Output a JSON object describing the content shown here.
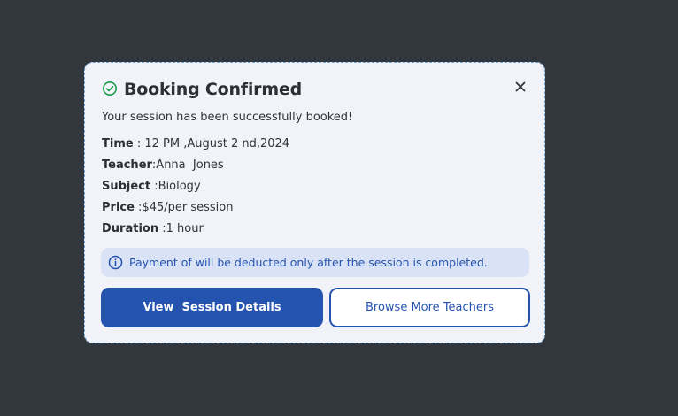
{
  "modal": {
    "title": "Booking Confirmed",
    "subtitle": "Your session has been successfully booked!",
    "close_icon": "close-icon",
    "status_icon": "check-circle-icon",
    "details": [
      {
        "key": "Time",
        "value": " : 12 PM ,August 2 nd,2024"
      },
      {
        "key": "Teacher",
        "value": ":Anna  Jones"
      },
      {
        "key": "Subject",
        "value": " :Biology"
      },
      {
        "key": "Price",
        "value": " :$45/per session"
      },
      {
        "key": "Duration",
        "value": " :1 hour"
      }
    ],
    "info": {
      "icon": "info-icon",
      "text": "Payment of will be deducted only after the session is completed."
    },
    "buttons": {
      "primary_label": "View  Session Details",
      "secondary_label": "Browse More Teachers"
    }
  },
  "colors": {
    "backdrop": "#32373e",
    "modal_bg": "#f1f3f8",
    "accent": "#2553b0",
    "success": "#1f9d4a",
    "info_bg": "#d9e3f5"
  }
}
